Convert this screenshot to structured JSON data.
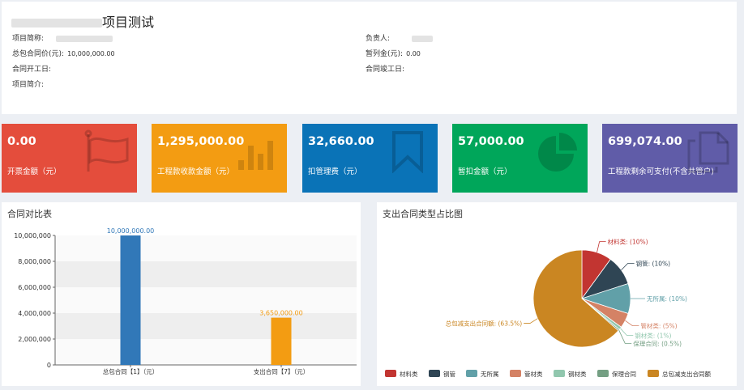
{
  "project": {
    "title": "项目测试",
    "fields": [
      {
        "label": "项目简称:",
        "value": ""
      },
      {
        "label": "负责人:",
        "value": ""
      },
      {
        "label": "总包合同价(元):",
        "value": "10,000,000.00"
      },
      {
        "label": "暂列金(元):",
        "value": "0.00"
      },
      {
        "label": "合同开工日:",
        "value": ""
      },
      {
        "label": "合同竣工日:",
        "value": ""
      },
      {
        "label": "项目简介:",
        "value": ""
      }
    ]
  },
  "cards": [
    {
      "value": "0.00",
      "label": "开票金额（元）",
      "color": "#e44d3c",
      "icon": "flag-icon"
    },
    {
      "value": "1,295,000.00",
      "label": "工程款收款金额（元）",
      "color": "#f39c12",
      "icon": "bar-chart-icon"
    },
    {
      "value": "32,660.00",
      "label": "扣管理费（元）",
      "color": "#0a73b7",
      "icon": "bookmark-icon"
    },
    {
      "value": "57,000.00",
      "label": "暂扣金额（元）",
      "color": "#00a65a",
      "icon": "pie-chart-icon"
    },
    {
      "value": "699,074.00",
      "label": "工程款剩余可支付(不含共管户)",
      "color": "#605ca8",
      "icon": "files-icon"
    }
  ],
  "bar_panel": {
    "title": "合同对比表"
  },
  "pie_panel": {
    "title": "支出合同类型占比图"
  },
  "chart_data": [
    {
      "type": "bar",
      "title": "合同对比表",
      "categories": [
        "总包合同【1】（元）",
        "支出合同【7】（元）"
      ],
      "values": [
        10000000,
        3650000
      ],
      "value_labels": [
        "10,000,000.00",
        "3,650,000.00"
      ],
      "colors": [
        "#3178b8",
        "#f39c12"
      ],
      "ylim": [
        0,
        10000000
      ],
      "yticks": [
        "0",
        "2,000,000",
        "4,000,000",
        "6,000,000",
        "8,000,000",
        "10,000,000"
      ],
      "grid": true
    },
    {
      "type": "pie",
      "title": "支出合同类型占比图",
      "legend_position": "bottom",
      "slices": [
        {
          "name": "材料类",
          "value": 10,
          "label": "材料类: (10%)",
          "color": "#c23531"
        },
        {
          "name": "钢管",
          "value": 10,
          "label": "钢管: (10%)",
          "color": "#2f4554"
        },
        {
          "name": "无所属",
          "value": 10,
          "label": "无所属: (10%)",
          "color": "#61a0a8"
        },
        {
          "name": "管材类",
          "value": 5,
          "label": "管材类: (5%)",
          "color": "#d48265"
        },
        {
          "name": "钢材类",
          "value": 1,
          "label": "钢材类: (1%)",
          "color": "#91c7ae"
        },
        {
          "name": "保理合同",
          "value": 0.5,
          "label": "保理合同: (0.5%)",
          "color": "#749f83"
        },
        {
          "name": "总包减支出合同额",
          "value": 63.5,
          "label": "总包减支出合同额: (63.5%)",
          "color": "#ca8622"
        }
      ]
    }
  ]
}
